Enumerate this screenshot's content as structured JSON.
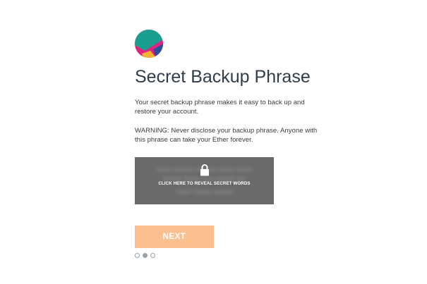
{
  "account": {
    "avatar_icon": "jazzicon-avatar",
    "avatar_colors": [
      "#e0247d",
      "#1a9e8f",
      "#f3b431",
      "#274f9e"
    ]
  },
  "page": {
    "title": "Secret Backup Phrase",
    "intro": "Your secret backup phrase makes it easy to back up and restore your account.",
    "warning": "WARNING: Never disclose your backup phrase. Anyone with this phrase can take your Ether forever."
  },
  "secret_box": {
    "reveal_label": "CLICK HERE TO REVEAL SECRET WORDS",
    "lock_icon": "lock-icon",
    "background": "#6a6a6a"
  },
  "actions": {
    "next_label": "NEXT",
    "next_color": "#fbc08f"
  },
  "pager": {
    "total": 3,
    "current": 2
  }
}
